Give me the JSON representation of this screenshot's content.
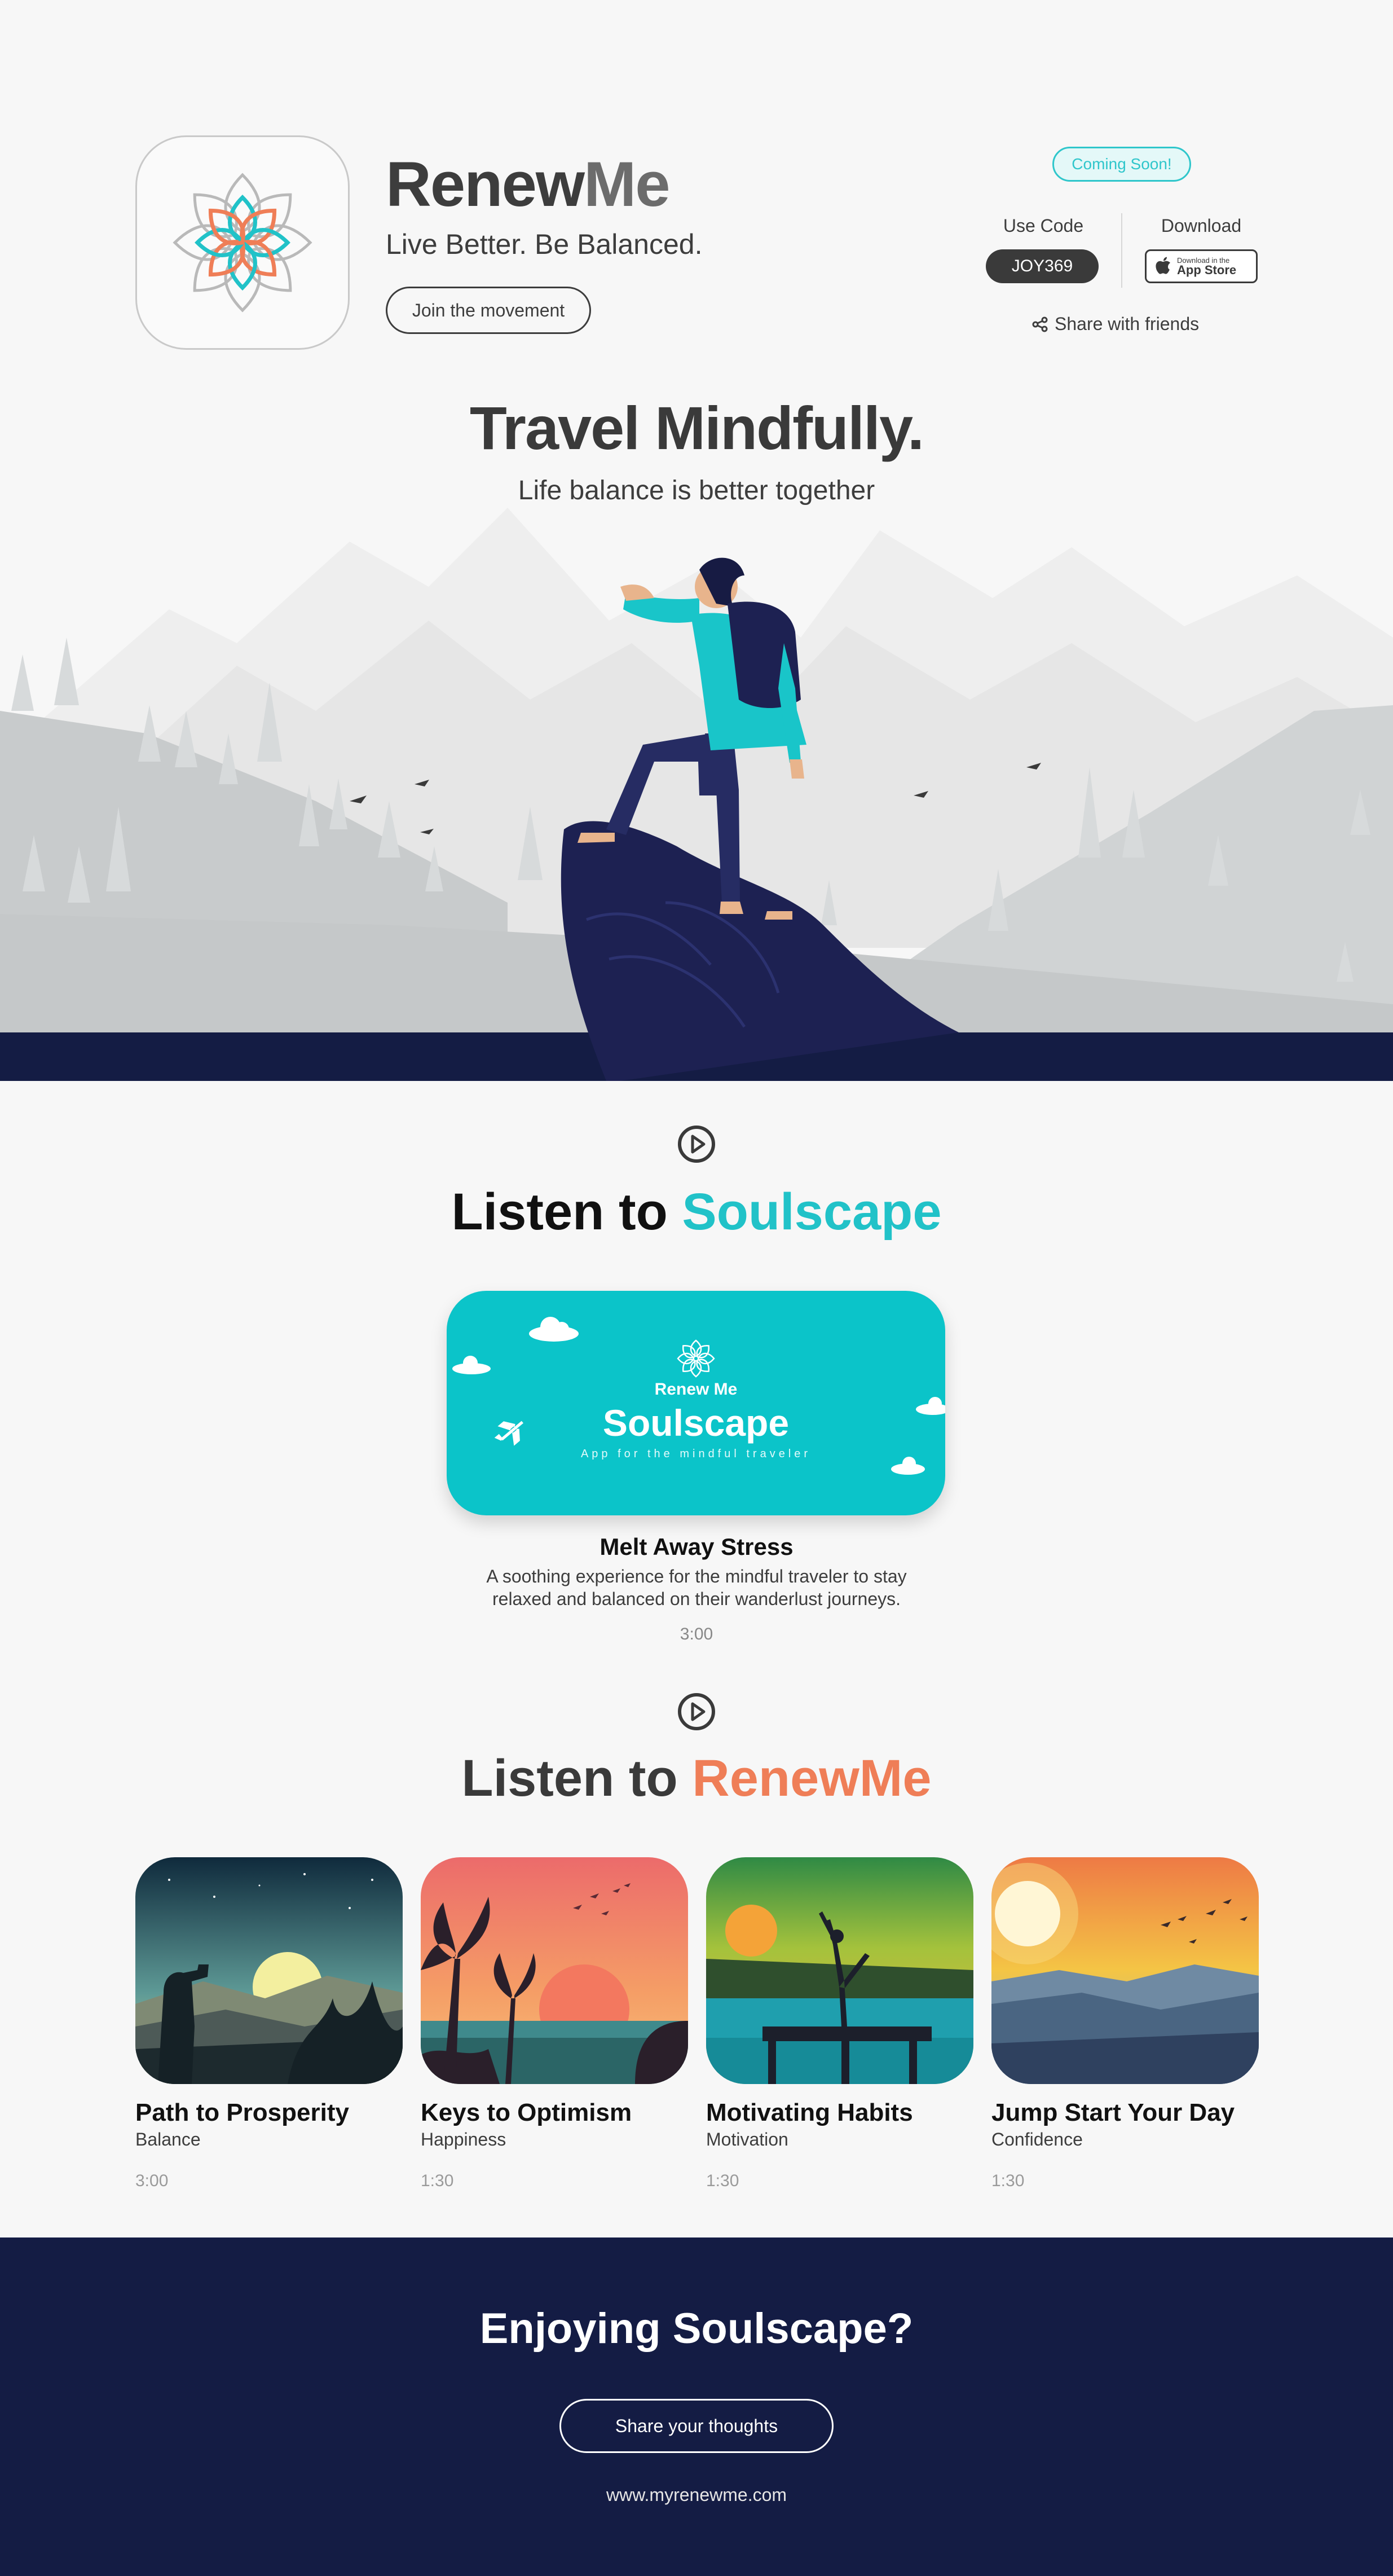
{
  "header": {
    "brand_part1": "Renew",
    "brand_part2": "Me",
    "tagline": "Live Better. Be Balanced.",
    "join_label": "Join the movement",
    "coming_soon": "Coming Soon!",
    "use_code_label": "Use Code",
    "code": "JOY369",
    "download_label": "Download",
    "appstore_small": "Download in the",
    "appstore_big": "App Store",
    "share_label": "Share with friends"
  },
  "hero": {
    "title": "Travel Mindfully.",
    "subtitle": "Life balance is better together"
  },
  "soulscape": {
    "heading_prefix": "Listen to",
    "heading_accent": "Soulscape",
    "card_brand": "Renew Me",
    "card_title": "Soulscape",
    "card_subtitle": "App for the mindful traveler",
    "track_title": "Melt Away Stress",
    "track_description": "A soothing experience for the mindful traveler to stay relaxed and balanced on their wanderlust journeys.",
    "track_duration": "3:00"
  },
  "renewme": {
    "heading_prefix": "Listen to",
    "heading_accent": "RenewMe",
    "episodes": [
      {
        "title": "Path to Prosperity",
        "category": "Balance",
        "duration": "3:00"
      },
      {
        "title": "Keys to Optimism",
        "category": "Happiness",
        "duration": "1:30"
      },
      {
        "title": "Motivating Habits",
        "category": "Motivation",
        "duration": "1:30"
      },
      {
        "title": "Jump Start Your Day",
        "category": "Confidence",
        "duration": "1:30"
      }
    ]
  },
  "footer": {
    "title": "Enjoying Soulscape?",
    "share_label": "Share your thoughts",
    "url": "www.myrenewme.com"
  },
  "colors": {
    "teal": "#21c2c8",
    "orange": "#ef7e57",
    "navy": "#141c44",
    "dark_text": "#3a3a3a"
  },
  "icons": [
    "lotus-logo-icon",
    "apple-icon",
    "share-icon",
    "play-circle-icon",
    "airplane-icon",
    "cloud-icon"
  ]
}
